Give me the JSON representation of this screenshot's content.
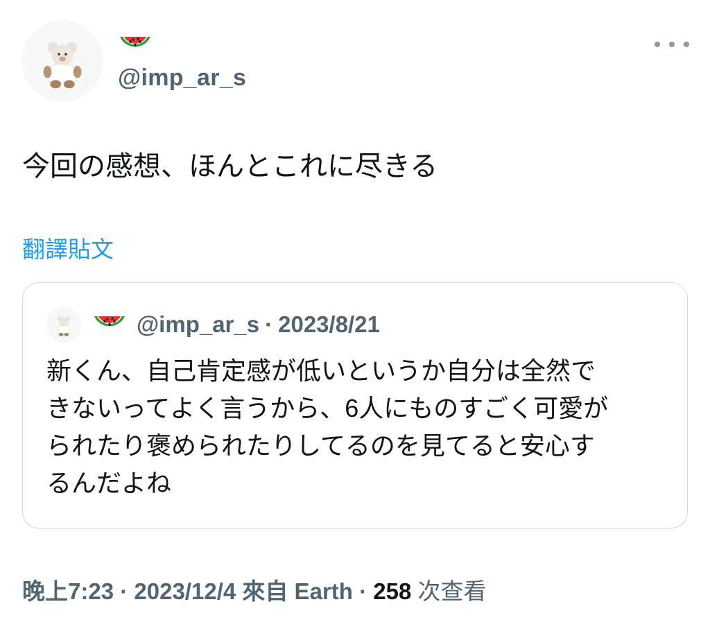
{
  "author": {
    "display_name_icon": "watermelon-emoji",
    "handle": "@imp_ar_s"
  },
  "tweet": {
    "text": "今回の感想、ほんとこれに尽きる",
    "translate_label": "翻譯貼文"
  },
  "quoted": {
    "handle": "@imp_ar_s",
    "separator": "·",
    "date": "2023/8/21",
    "text_lines": [
      "新くん、自己肯定感が低いというか自分は全然で",
      "きないってよく言うから、6人にものすごく可愛が",
      "られたり褒められたりしてるのを見てると安心す",
      "るんだよね"
    ]
  },
  "meta": {
    "time": "晚上7:23",
    "separator": "·",
    "date": "2023/12/4",
    "source": "來自 Earth",
    "views_count": "258",
    "views_label": "次查看"
  },
  "colors": {
    "link": "#1d9bf0",
    "secondary_text": "#536471",
    "primary_text": "#0f1419",
    "border": "#cfd9de"
  }
}
